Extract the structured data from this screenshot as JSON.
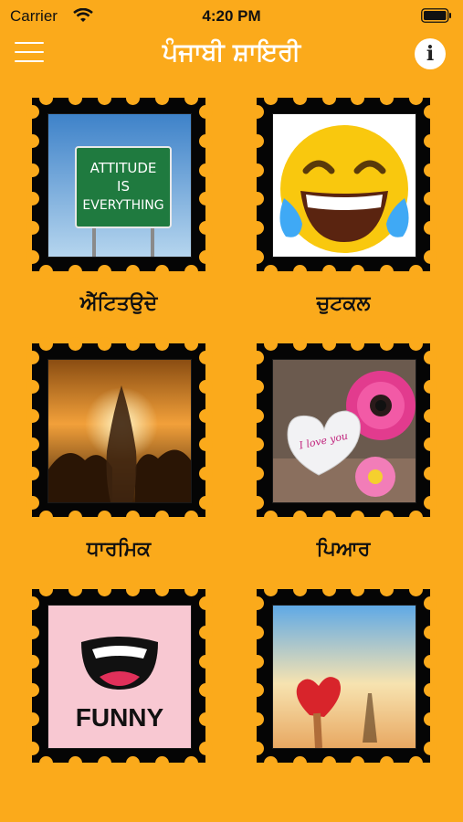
{
  "status": {
    "carrier": "Carrier",
    "time": "4:20 PM"
  },
  "header": {
    "title": "ਪੰਜਾਬੀ ਸ਼ਾਇਰੀ",
    "info_label": "i"
  },
  "categories": [
    {
      "label": "ਐੱਟਿਤਉਦੇ",
      "image": "attitude-sign",
      "sign_text": [
        "ATTITUDE",
        "IS",
        "EVERYTHING"
      ]
    },
    {
      "label": "ਚੁਟਕਲ",
      "image": "laughing-emoji"
    },
    {
      "label": "ਧਾਰਮਿਕ",
      "image": "praying-hands"
    },
    {
      "label": "ਪਿਆਰ",
      "image": "love-heart-flowers",
      "heart_text": "I love you"
    },
    {
      "label": "",
      "image": "funny-mouth",
      "image_text": "FUNNY"
    },
    {
      "label": "",
      "image": "heart-eiffel"
    }
  ],
  "colors": {
    "background": "#FBAA1B",
    "stamp": "#050505"
  }
}
